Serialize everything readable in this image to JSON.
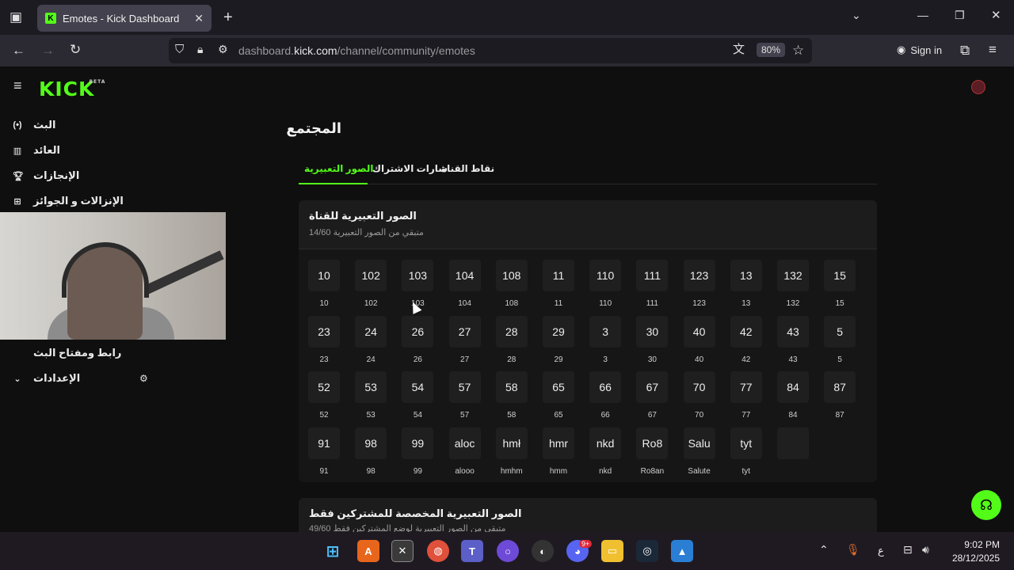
{
  "browser": {
    "tab_title": "Emotes - Kick Dashboard",
    "url_domain_prefix": "dashboard.",
    "url_domain": "kick.com",
    "url_path": "/channel/community/emotes",
    "zoom": "80%",
    "sign_in": "Sign in"
  },
  "sidebar": {
    "logo": "KICK",
    "logo_badge": "BETA",
    "items": [
      {
        "label": "البث",
        "icon": "broadcast-icon"
      },
      {
        "label": "العائد",
        "icon": "chart-icon"
      },
      {
        "label": "الإنجازات",
        "icon": "trophy-icon"
      },
      {
        "label": "الإنزالات و الجوائز",
        "icon": "gift-icon"
      }
    ],
    "stream_key": "رابط ومفتاح البث",
    "settings": "الإعدادات"
  },
  "main": {
    "title": "المجتمع",
    "tabs": [
      "الصور التعبيرية",
      "شارات الاشتراك",
      "نقاط القناة"
    ],
    "channel_emotes": {
      "title": "الصور التعبيرية للقناة",
      "subtitle": "متبقي من الصور التعبيرية 14/60",
      "emotes": [
        {
          "thumb": "10",
          "label": "10"
        },
        {
          "thumb": "102",
          "label": "102"
        },
        {
          "thumb": "103",
          "label": "103"
        },
        {
          "thumb": "104",
          "label": "104"
        },
        {
          "thumb": "108",
          "label": "108"
        },
        {
          "thumb": "11",
          "label": "11"
        },
        {
          "thumb": "110",
          "label": "110"
        },
        {
          "thumb": "111",
          "label": "111"
        },
        {
          "thumb": "123",
          "label": "123"
        },
        {
          "thumb": "13",
          "label": "13"
        },
        {
          "thumb": "132",
          "label": "132"
        },
        {
          "thumb": "15",
          "label": "15"
        },
        {
          "thumb": "23",
          "label": "23"
        },
        {
          "thumb": "24",
          "label": "24"
        },
        {
          "thumb": "26",
          "label": "26"
        },
        {
          "thumb": "27",
          "label": "27"
        },
        {
          "thumb": "28",
          "label": "28"
        },
        {
          "thumb": "29",
          "label": "29"
        },
        {
          "thumb": "3",
          "label": "3"
        },
        {
          "thumb": "30",
          "label": "30"
        },
        {
          "thumb": "40",
          "label": "40"
        },
        {
          "thumb": "42",
          "label": "42"
        },
        {
          "thumb": "43",
          "label": "43"
        },
        {
          "thumb": "5",
          "label": "5"
        },
        {
          "thumb": "52",
          "label": "52"
        },
        {
          "thumb": "53",
          "label": "53"
        },
        {
          "thumb": "54",
          "label": "54"
        },
        {
          "thumb": "57",
          "label": "57"
        },
        {
          "thumb": "58",
          "label": "58"
        },
        {
          "thumb": "65",
          "label": "65"
        },
        {
          "thumb": "66",
          "label": "66"
        },
        {
          "thumb": "67",
          "label": "67"
        },
        {
          "thumb": "70",
          "label": "70"
        },
        {
          "thumb": "77",
          "label": "77"
        },
        {
          "thumb": "84",
          "label": "84"
        },
        {
          "thumb": "87",
          "label": "87"
        },
        {
          "thumb": "91",
          "label": "91"
        },
        {
          "thumb": "98",
          "label": "98"
        },
        {
          "thumb": "99",
          "label": "99"
        },
        {
          "thumb": "aloc",
          "label": "alooo"
        },
        {
          "thumb": "hmł",
          "label": "hmhm"
        },
        {
          "thumb": "hmr",
          "label": "hmm"
        },
        {
          "thumb": "nkd",
          "label": "nkd"
        },
        {
          "thumb": "Ro8",
          "label": "Ro8an"
        },
        {
          "thumb": "Salu",
          "label": "Salute"
        },
        {
          "thumb": "tyt",
          "label": "tyt"
        },
        {
          "thumb": "",
          "label": ""
        }
      ]
    },
    "sub_emotes": {
      "title": "الصور التعبيرية المخصصة للمشتركين فقط",
      "subtitle": "متبقي من الصور التعبيرية لوضع المشتركين فقط 49/60"
    }
  },
  "taskbar": {
    "time": "9:02 PM",
    "date": "28/12/2025",
    "lang": "ع",
    "discord_badge": "9+"
  },
  "colors": {
    "accent": "#53fc18",
    "background": "#0f0f0f",
    "card": "#161616"
  }
}
